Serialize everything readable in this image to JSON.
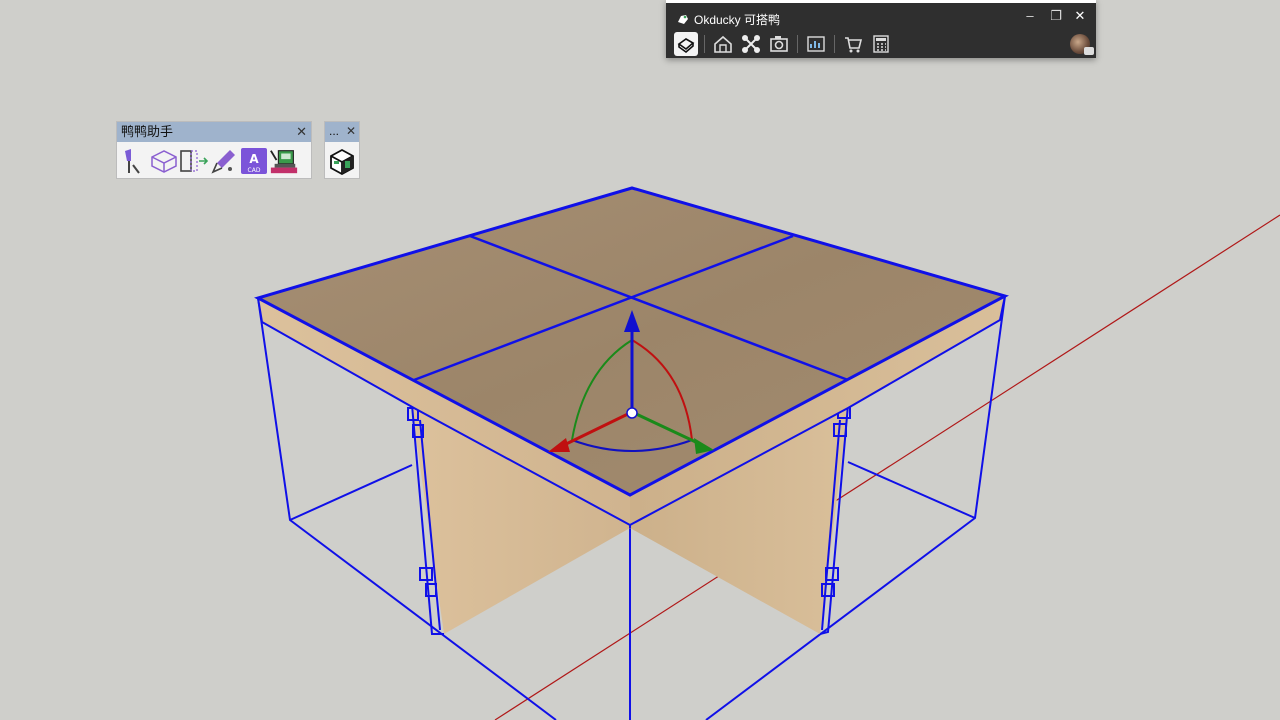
{
  "okducky": {
    "title": "Okducky 可搭鸭",
    "minimize_label": "–",
    "restore_label": "❐",
    "close_label": "✕",
    "tools": [
      "box-tool-icon",
      "house-icon",
      "nodes-icon",
      "camera-icon",
      "chart-icon",
      "cart-icon",
      "calculator-icon"
    ]
  },
  "yaya": {
    "title": "鸭鸭助手",
    "close_label": "✕",
    "tools": [
      "knife-icon",
      "box-section-icon",
      "split-icon",
      "eyedropper-icon",
      "cad-icon",
      "machine-icon"
    ]
  },
  "mini_toolbar": {
    "title": "...",
    "close_label": "✕"
  },
  "colors": {
    "background": "#cfcfcb",
    "selection": "#1010e8",
    "wood_top": "#a08a6f",
    "wood_side": "#d8bf9a",
    "axis_red": "#b01010",
    "axis_green": "#1a8a1a",
    "axis_blue": "#1010d0"
  }
}
